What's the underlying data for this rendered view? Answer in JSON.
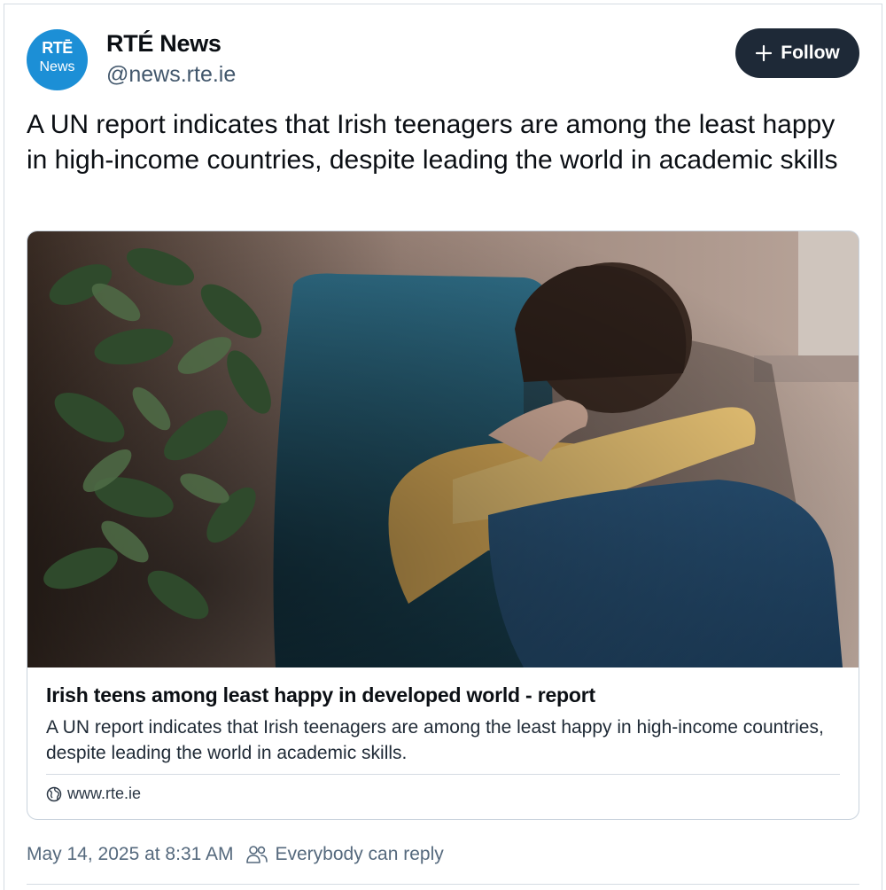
{
  "author": {
    "avatar_line1": "RTĒ",
    "avatar_line2": "News",
    "display_name": "RTÉ News",
    "handle": "@news.rte.ie"
  },
  "follow_button": {
    "label": "Follow",
    "icon": "plus-icon"
  },
  "post": {
    "text": "A UN report indicates that Irish teenagers are among the least happy in high-income countries, despite leading the world in academic skills"
  },
  "link_card": {
    "image": "photo of a teenage girl hugging her knees beside a blue armchair and a houseplant",
    "title": "Irish teens among least happy in developed world - report",
    "description": "A UN report indicates that Irish teenagers are among the least happy in high-income countries, despite leading the world in academic skills.",
    "domain": "www.rte.ie",
    "domain_icon": "globe-icon"
  },
  "meta": {
    "timestamp": "May 14, 2025 at 8:31 AM",
    "reply_setting": "Everybody can reply",
    "reply_icon": "people-icon"
  },
  "colors": {
    "avatar": "#1c8fd6",
    "follow_button": "#1e2937",
    "muted_text": "#55697d"
  }
}
